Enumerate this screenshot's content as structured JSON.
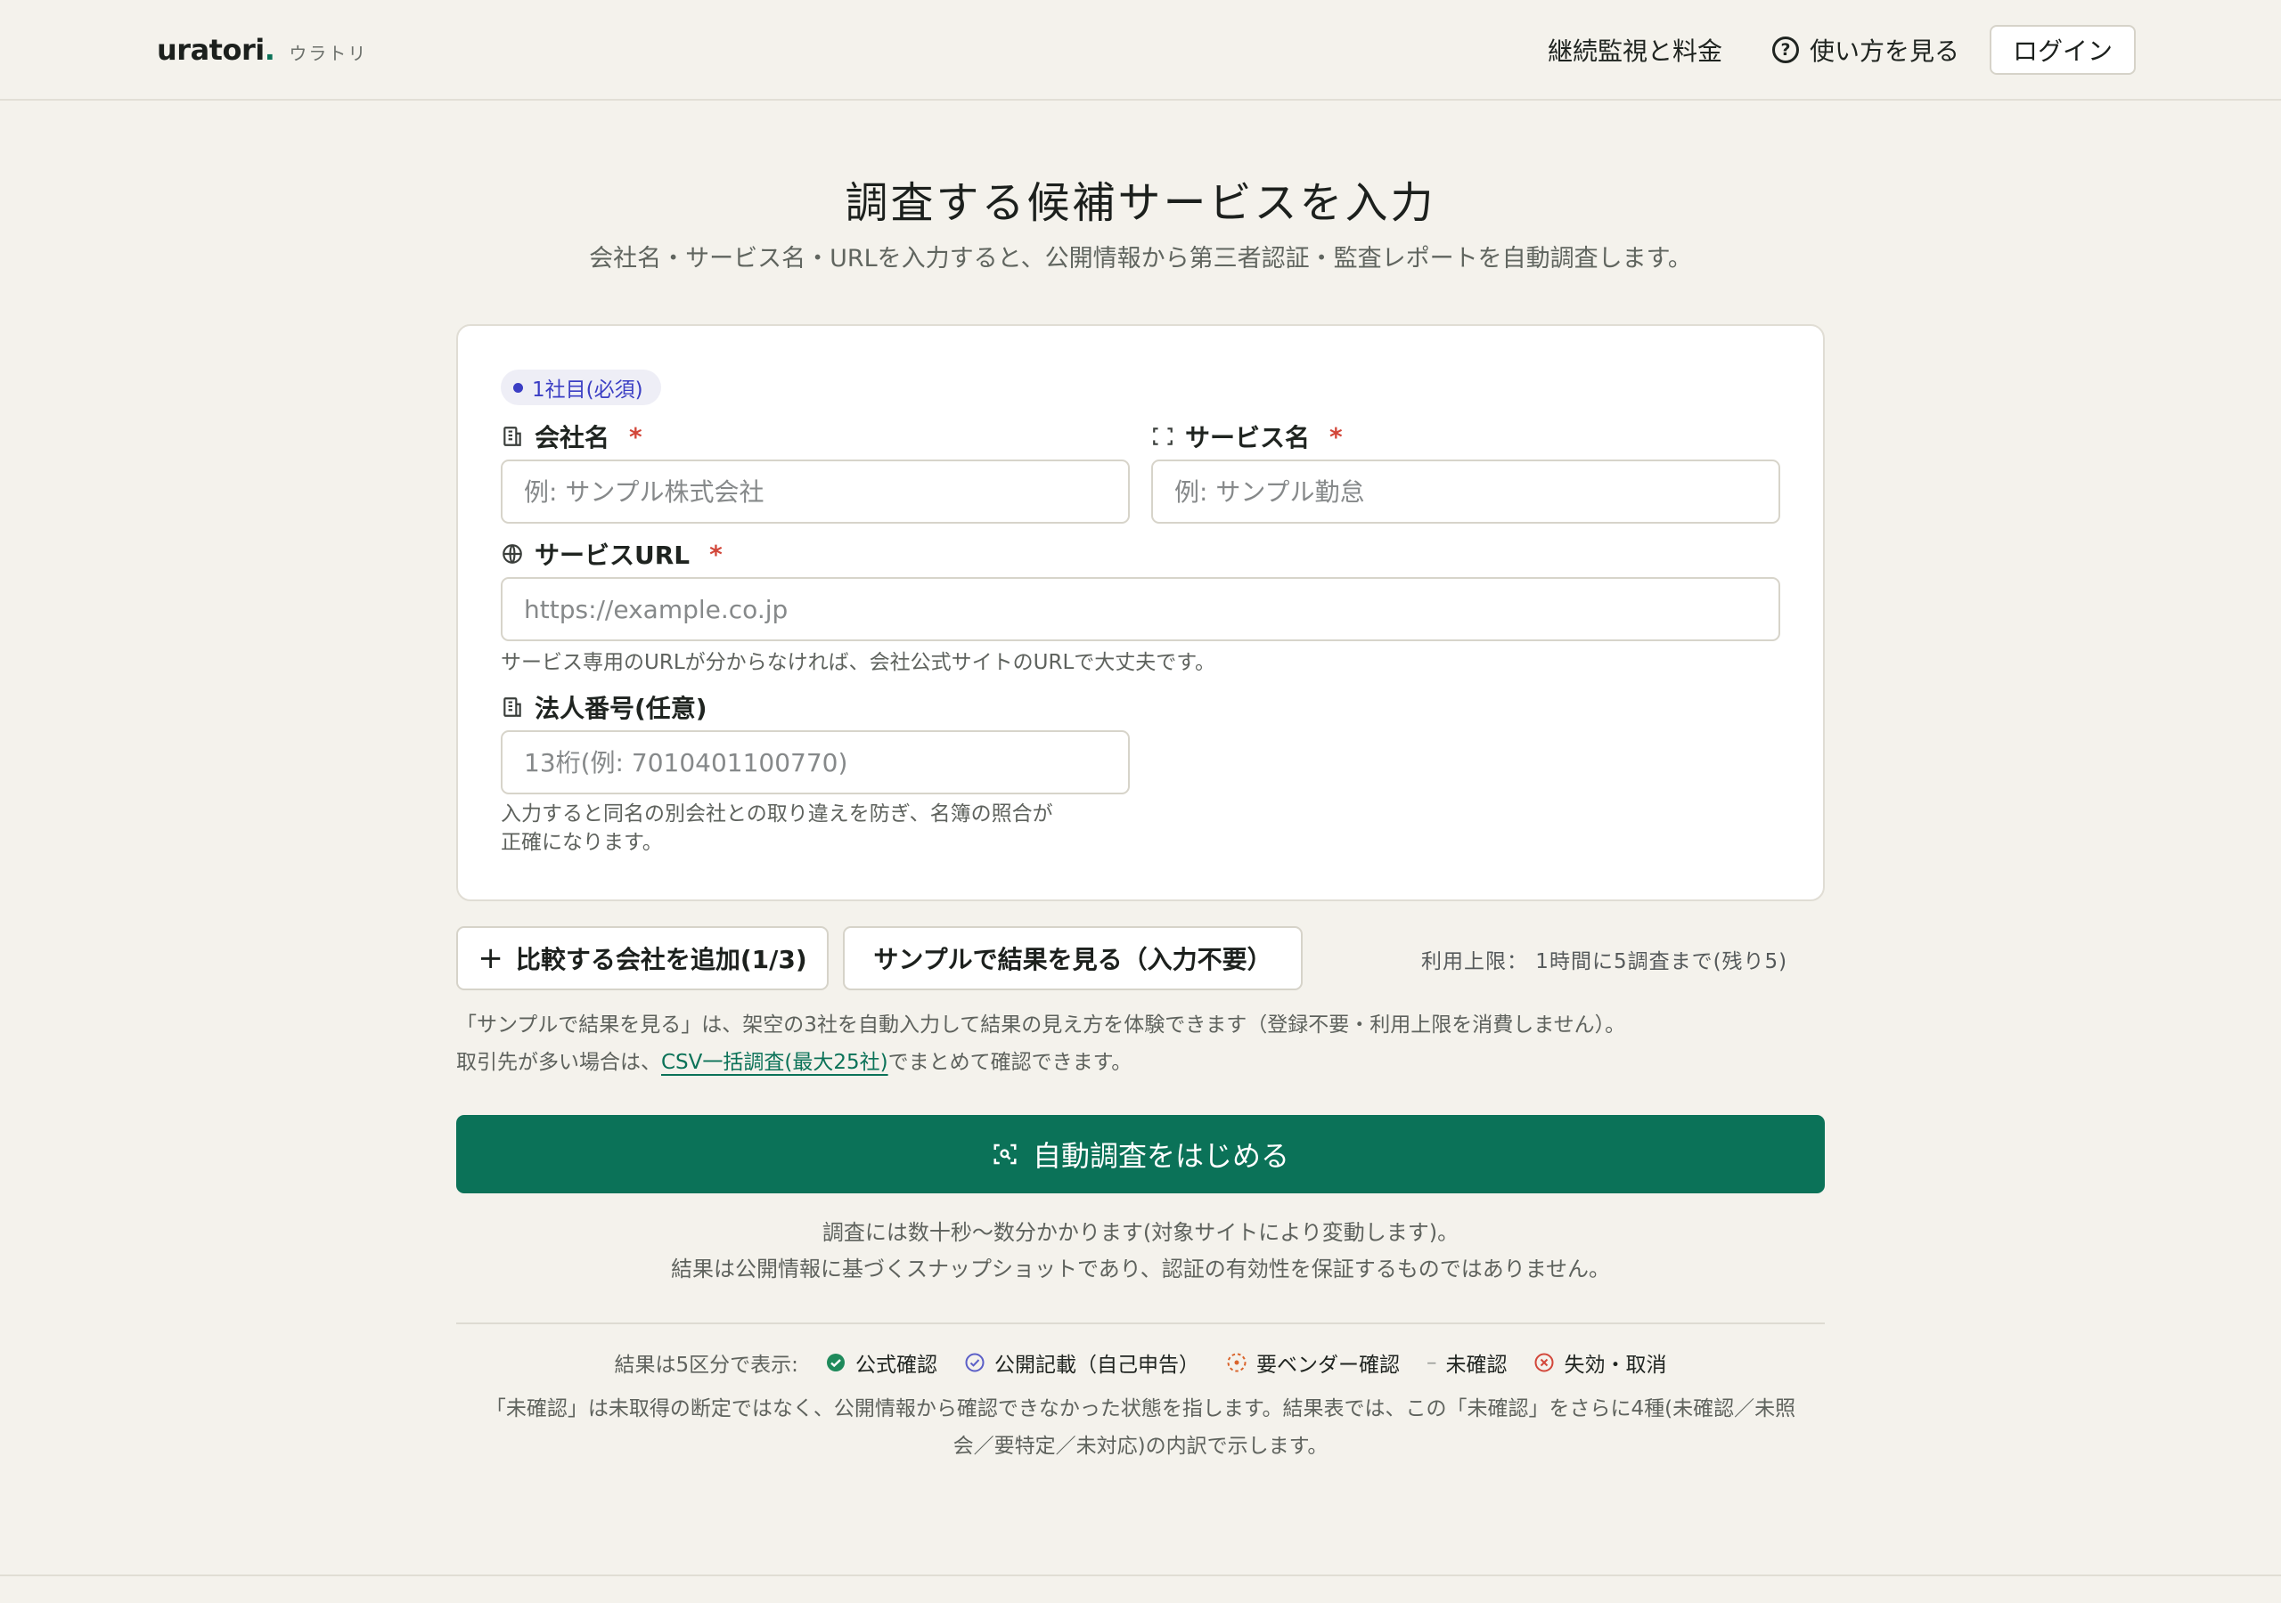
{
  "header": {
    "brand_name": "uratori",
    "brand_dot": ".",
    "brand_kana": "ウラトリ",
    "nav_pricing": "継続監視と料金",
    "nav_help": "使い方を見る",
    "login": "ログイン"
  },
  "hero": {
    "title": "調査する候補サービスを入力",
    "subtitle": "会社名・サービス名・URLを入力すると、公開情報から第三者認証・監査レポートを自動調査します。"
  },
  "form": {
    "badge": "1社目(必須)",
    "company_label": "会社名",
    "company_placeholder": "例: サンプル株式会社",
    "service_label": "サービス名",
    "service_placeholder": "例: サンプル勤怠",
    "url_label": "サービスURL",
    "url_placeholder": "https://example.co.jp",
    "url_hint": "サービス専用のURLが分からなければ、会社公式サイトのURLで大丈夫です。",
    "corp_label": "法人番号(任意)",
    "corp_placeholder": "13桁(例: 7010401100770)",
    "corp_hint_1": "入力すると同名の別会社との取り違えを防ぎ、名簿の照合が",
    "corp_hint_2": "正確になります。",
    "required_mark": "*"
  },
  "actions": {
    "add_company": "比較する会社を追加(1/3)",
    "sample": "サンプルで結果を見る（入力不要）",
    "limit": "利用上限： 1時間に5調査まで(残り5)",
    "sample_note": "「サンプルで結果を見る」は、架空の3社を自動入力して結果の見え方を体験できます（登録不要・利用上限を消費しません）。",
    "csv_prefix": "取引先が多い場合は、",
    "csv_link": "CSV一括調査(最大25社)",
    "csv_suffix": "でまとめて確認できます。",
    "start": "自動調査をはじめる",
    "time_note": "調査には数十秒～数分かかります(対象サイトにより変動します)。",
    "disclaimer": "結果は公開情報に基づくスナップショットであり、認証の有効性を保証するものではありません。"
  },
  "legend": {
    "lead": "結果は5区分で表示:",
    "items": [
      "公式確認",
      "公開記載（自己申告）",
      "要ベンダー確認",
      "未確認",
      "失効・取消"
    ],
    "dash": "–",
    "colors": {
      "official": "#1f8a5b",
      "public": "#5b5fc7",
      "vendor": "#d9642c",
      "unconfirmed": "#9a9d98",
      "revoked": "#d2473a"
    },
    "note_1": "「未確認」は未取得の断定ではなく、公開情報から確認できなかった状態を指します。結果表では、この「未確認」をさらに4種(未確認／未照",
    "note_2": "会／要特定／未対応)の内訳で示します。"
  }
}
